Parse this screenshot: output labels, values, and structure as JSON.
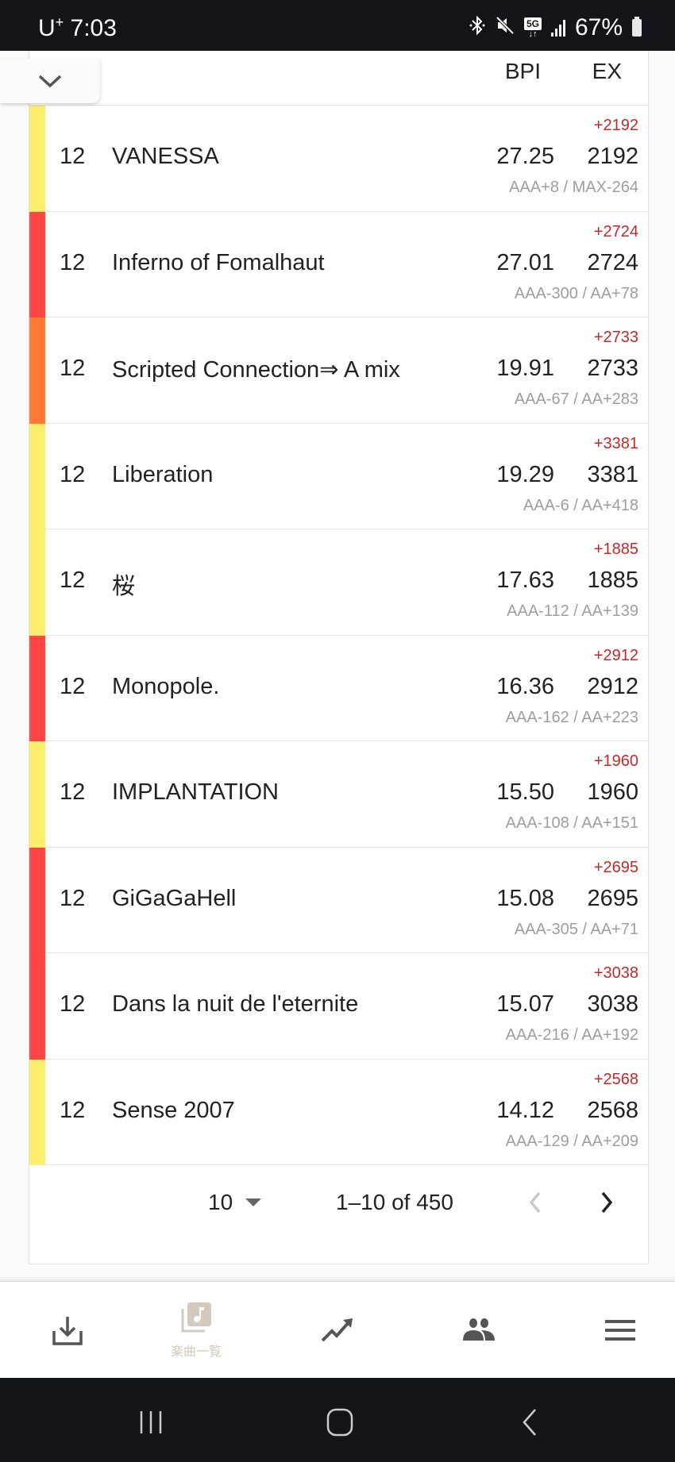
{
  "status_bar": {
    "carrier": "U",
    "carrier_sup": "+",
    "time": "7:03",
    "icons": [
      "bluetooth-icon",
      "mute-icon",
      "5g-icon",
      "signal-icon"
    ],
    "network": "5G",
    "battery": "67%"
  },
  "table": {
    "headers": {
      "bpi": "BPI",
      "ex": "EX"
    },
    "lamp_colors": {
      "hard": "#ff4444",
      "clear": "#ffee66",
      "easy": "#ff7733"
    },
    "rows": [
      {
        "level": "12",
        "title": "VANESSA",
        "diff": "+2192",
        "bpi": "27.25",
        "ex": "2192",
        "rank": "AAA+8 / MAX-264",
        "lamp": "#fdee6e"
      },
      {
        "level": "12",
        "title": "Inferno of Fomalhaut",
        "diff": "+2724",
        "bpi": "27.01",
        "ex": "2724",
        "rank": "AAA-300 / AA+78",
        "lamp": "#ff4545"
      },
      {
        "level": "12",
        "title": "Scripted Connection⇒ A mix",
        "diff": "+2733",
        "bpi": "19.91",
        "ex": "2733",
        "rank": "AAA-67 / AA+283",
        "lamp": "#ff7a35"
      },
      {
        "level": "12",
        "title": "Liberation",
        "diff": "+3381",
        "bpi": "19.29",
        "ex": "3381",
        "rank": "AAA-6 / AA+418",
        "lamp": "#fdee6e"
      },
      {
        "level": "12",
        "title": "桜",
        "diff": "+1885",
        "bpi": "17.63",
        "ex": "1885",
        "rank": "AAA-112 / AA+139",
        "lamp": "#fdee6e"
      },
      {
        "level": "12",
        "title": "Monopole.",
        "diff": "+2912",
        "bpi": "16.36",
        "ex": "2912",
        "rank": "AAA-162 / AA+223",
        "lamp": "#ff4545"
      },
      {
        "level": "12",
        "title": "IMPLANTATION",
        "diff": "+1960",
        "bpi": "15.50",
        "ex": "1960",
        "rank": "AAA-108 / AA+151",
        "lamp": "#fdee6e"
      },
      {
        "level": "12",
        "title": "GiGaGaHell",
        "diff": "+2695",
        "bpi": "15.08",
        "ex": "2695",
        "rank": "AAA-305 / AA+71",
        "lamp": "#ff4545"
      },
      {
        "level": "12",
        "title": "Dans la nuit de l'eternite",
        "diff": "+3038",
        "bpi": "15.07",
        "ex": "3038",
        "rank": "AAA-216 / AA+192",
        "lamp": "#ff4545"
      },
      {
        "level": "12",
        "title": "Sense 2007",
        "diff": "+2568",
        "bpi": "14.12",
        "ex": "2568",
        "rank": "AAA-129 / AA+209",
        "lamp": "#fdee6e"
      }
    ]
  },
  "pagination": {
    "rows_per_page": "10",
    "range": "1–10 of 450"
  },
  "bottom_nav": {
    "items": [
      {
        "icon": "download-icon",
        "label": ""
      },
      {
        "icon": "music-library-icon",
        "label": "楽曲一覧",
        "active": true
      },
      {
        "icon": "trending-icon",
        "label": ""
      },
      {
        "icon": "people-icon",
        "label": ""
      },
      {
        "icon": "menu-icon",
        "label": ""
      }
    ]
  },
  "colors": {
    "diff_red": "#c62828",
    "active_nav": "#d3c9bd",
    "icon_gray": "#555555"
  }
}
